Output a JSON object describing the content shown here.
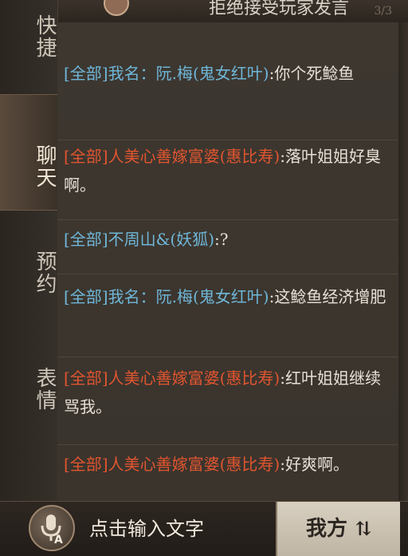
{
  "header": {
    "title": "拒绝接受玩家发言",
    "count": "3/3"
  },
  "tabs": [
    {
      "label": "快捷"
    },
    {
      "label": "聊天"
    },
    {
      "label": "预约"
    },
    {
      "label": "表情"
    }
  ],
  "messages": [
    {
      "tag": "[全部]",
      "sender": "我名：阮.梅(鬼女红叶)",
      "text": ":你个死鲶鱼",
      "color": "#6fb6d8"
    },
    {
      "tag": "[全部]",
      "sender": "人美心善嫁富婆(惠比寿)",
      "text": ":落叶姐姐好臭啊。",
      "color": "#e0552f"
    },
    {
      "tag": "[全部]",
      "sender": "不周山&(妖狐)",
      "text": ":?",
      "color": "#6fb6d8"
    },
    {
      "tag": "[全部]",
      "sender": "我名：阮.梅(鬼女红叶)",
      "text": ":这鲶鱼经济增肥",
      "color": "#6fb6d8"
    },
    {
      "tag": "[全部]",
      "sender": "人美心善嫁富婆(惠比寿)",
      "text": ":红叶姐姐继续骂我。",
      "color": "#e0552f"
    },
    {
      "tag": "[全部]",
      "sender": "人美心善嫁富婆(惠比寿)",
      "text": ":好爽啊。",
      "color": "#e0552f"
    }
  ],
  "input": {
    "placeholder": "点击输入文字",
    "voice_icon": "microphone-icon"
  },
  "send_button": {
    "label": "我方",
    "swap_glyph": "⇅"
  }
}
